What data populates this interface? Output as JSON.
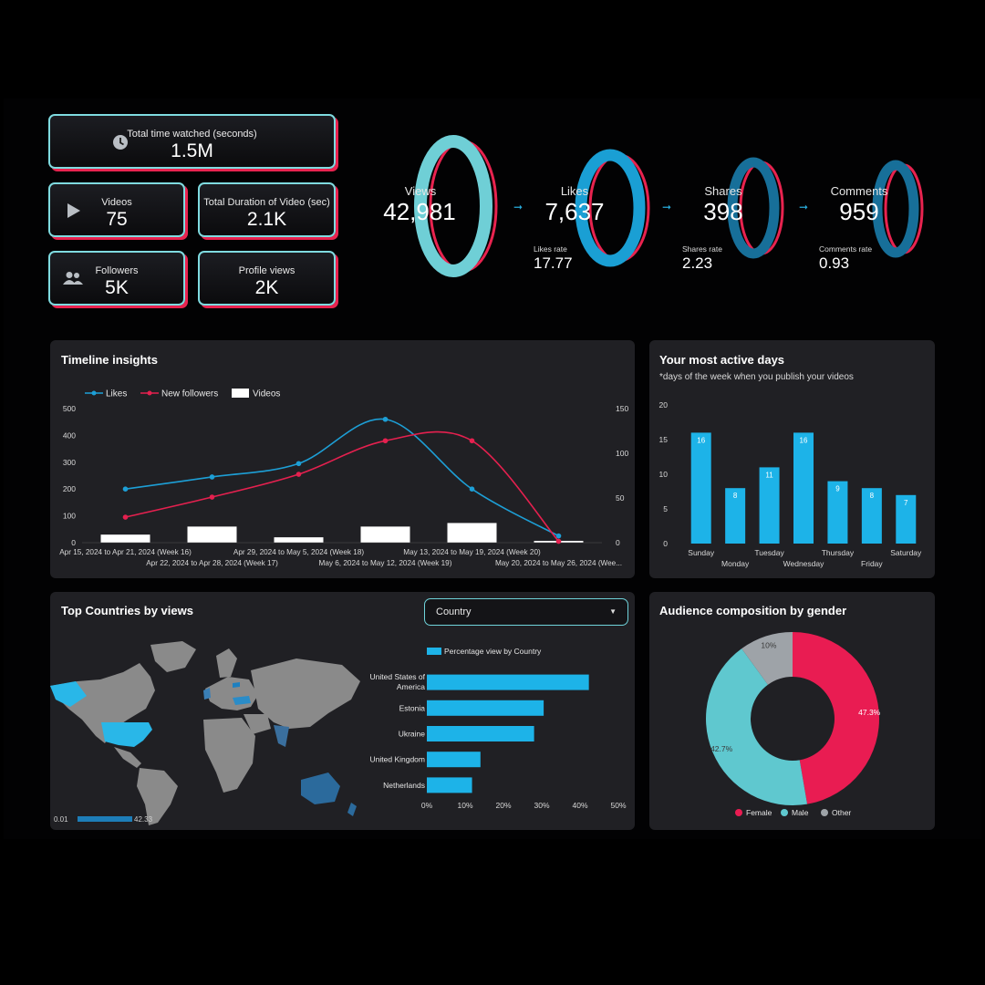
{
  "kpis": {
    "time_watched": {
      "label": "Total time watched (seconds)",
      "value": "1.5M",
      "icon": "clock-icon"
    },
    "videos": {
      "label": "Videos",
      "value": "75",
      "icon": "play-icon"
    },
    "duration": {
      "label": "Total Duration of Video (sec)",
      "value": "2.1K"
    },
    "followers": {
      "label": "Followers",
      "value": "5K",
      "icon": "users-icon"
    },
    "profile_views": {
      "label": "Profile views",
      "value": "2K"
    }
  },
  "funnel": {
    "views": {
      "label": "Views",
      "value": "42,981"
    },
    "likes": {
      "label": "Likes",
      "value": "7,637",
      "rate_label": "Likes rate",
      "rate_value": "17.77"
    },
    "shares": {
      "label": "Shares",
      "value": "398",
      "rate_label": "Shares rate",
      "rate_value": "2.23"
    },
    "comments": {
      "label": "Comments",
      "value": "959",
      "rate_label": "Comments rate",
      "rate_value": "0.93"
    }
  },
  "timeline": {
    "title": "Timeline insights",
    "legend": {
      "likes": "Likes",
      "followers": "New followers",
      "videos": "Videos"
    }
  },
  "active_days": {
    "title": "Your most active days",
    "subtitle": "*days of the week when you publish your videos"
  },
  "countries": {
    "title": "Top Countries by views",
    "select_value": "Country",
    "legend": "Percentage view by Country",
    "map_min_label": "0.01",
    "map_max_label": "42.33"
  },
  "gender": {
    "title": "Audience composition by gender"
  },
  "colors": {
    "accent_cyan": "#7fdbe0",
    "accent_red": "#e8234f",
    "bar_blue": "#1db3e8",
    "panel": "#202024"
  },
  "chart_data": [
    {
      "type": "line",
      "title": "Timeline insights",
      "categories": [
        "Apr 15, 2024 to Apr 21, 2024 (Week 16)",
        "Apr 22, 2024 to Apr 28, 2024 (Week 17)",
        "Apr 29, 2024 to May 5, 2024 (Week 18)",
        "May 6, 2024 to May 12, 2024 (Week 19)",
        "May 13, 2024 to May 19, 2024 (Week 20)",
        "May 20, 2024 to May 26, 2024 (Wee..."
      ],
      "series": [
        {
          "name": "Likes",
          "axis": "left",
          "values": [
            200,
            245,
            295,
            460,
            200,
            25
          ]
        },
        {
          "name": "New followers",
          "axis": "left",
          "values": [
            95,
            170,
            255,
            380,
            380,
            5
          ]
        },
        {
          "name": "Videos",
          "axis": "right",
          "kind": "bar",
          "values": [
            9,
            18,
            6,
            18,
            22,
            2
          ]
        }
      ],
      "ylim_left": [
        0,
        500
      ],
      "ylim_right": [
        0,
        150
      ],
      "yticks_left": [
        "0",
        "100",
        "200",
        "300",
        "400",
        "500"
      ],
      "yticks_right": [
        "0",
        "50",
        "100",
        "150"
      ]
    },
    {
      "type": "bar",
      "title": "Your most active days",
      "categories": [
        "Sunday",
        "Monday",
        "Tuesday",
        "Wednesday",
        "Thursday",
        "Friday",
        "Saturday"
      ],
      "values": [
        16,
        8,
        11,
        16,
        9,
        8,
        7
      ],
      "ylim": [
        0,
        20
      ],
      "yticks": [
        "0",
        "5",
        "10",
        "15",
        "20"
      ]
    },
    {
      "type": "bar",
      "orientation": "horizontal",
      "title": "Top Countries by views",
      "legend": "Percentage view by Country",
      "categories": [
        "United States of America",
        "Estonia",
        "Ukraine",
        "United Kingdom",
        "Netherlands"
      ],
      "values": [
        42.3,
        30.5,
        28,
        14,
        11.8
      ],
      "xlim": [
        0,
        50
      ],
      "xticks": [
        "0%",
        "10%",
        "20%",
        "30%",
        "40%",
        "50%"
      ]
    },
    {
      "type": "pie",
      "title": "Audience composition by gender",
      "categories": [
        "Female",
        "Male",
        "Other"
      ],
      "values": [
        47.3,
        42.7,
        10
      ],
      "labels": [
        "47.3%",
        "42.7%",
        "10%"
      ],
      "colors": [
        "#e91c52",
        "#5fc8cf",
        "#9ea3a8"
      ]
    }
  ]
}
